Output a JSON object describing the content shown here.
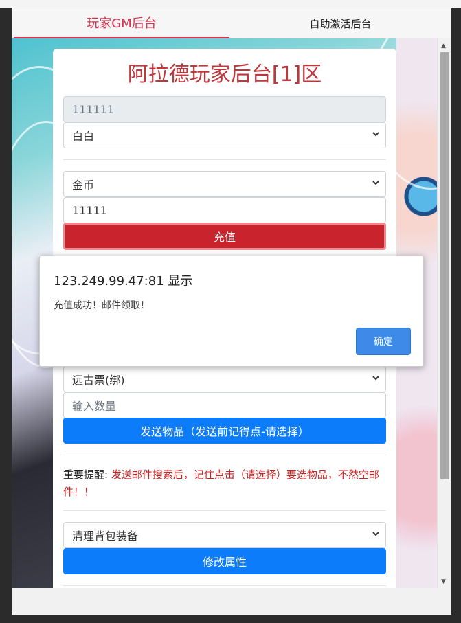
{
  "tabs": [
    {
      "label": "玩家GM后台",
      "active": true
    },
    {
      "label": "自助激活后台",
      "active": false
    }
  ],
  "card": {
    "title": "阿拉德玩家后台[1]区",
    "account_value": "111111",
    "role_select": "白白",
    "currency_select": "金币",
    "amount_value": "11111",
    "recharge_button": "充值",
    "item_select": "远古票(绑)",
    "quantity_placeholder": "输入数量",
    "send_button": "发送物品（发送前记得点-请选择）",
    "notice_label": "重要提醒:",
    "notice_text": "发送邮件搜索后，记住点击（请选择）要选物品，不然空邮件！！",
    "action_select": "清理背包装备",
    "modify_button": "修改属性"
  },
  "dialog": {
    "title": "123.249.99.47:81 显示",
    "message": "充值成功！邮件领取！",
    "ok_button": "确定"
  },
  "colors": {
    "accent": "#d9304f",
    "title_red": "#c0363a",
    "recharge_red": "#c9232e",
    "primary_blue": "#0c7cfb",
    "dialog_blue": "#3e8ae8"
  }
}
